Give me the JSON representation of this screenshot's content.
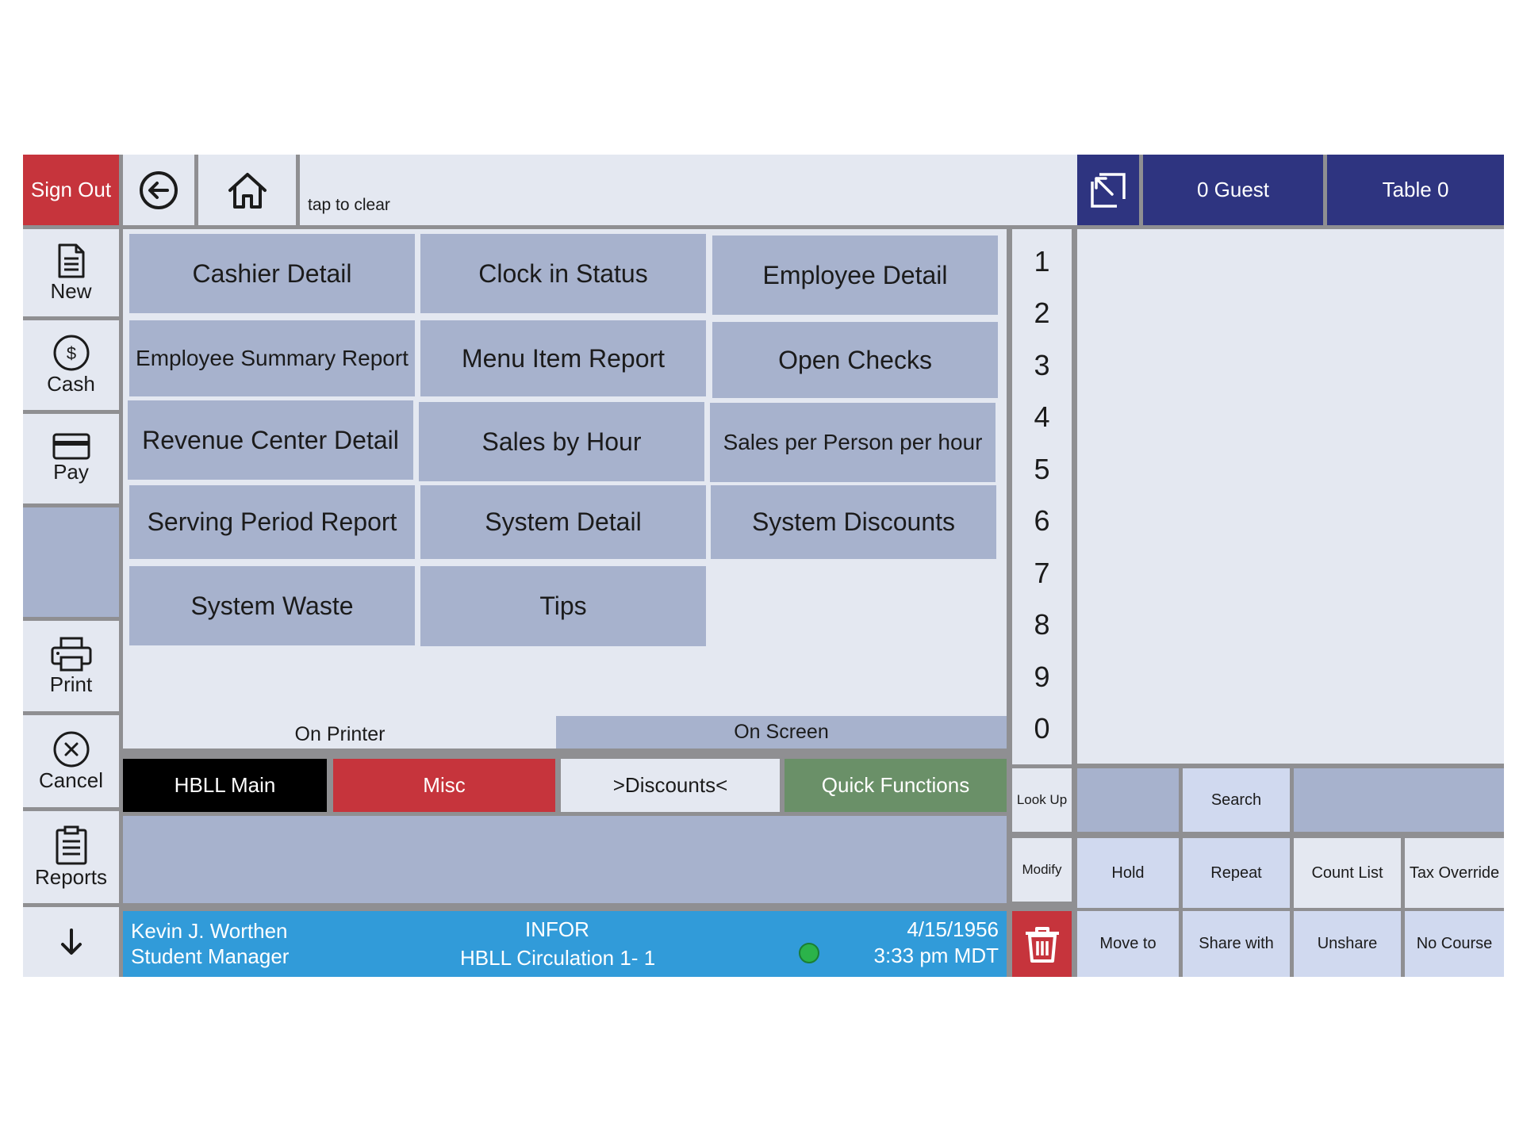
{
  "topbar": {
    "sign_out": "Sign Out",
    "back_icon": "back-arrow-icon",
    "home_icon": "home-icon",
    "input_hint": "tap to clear",
    "expand_icon": "expand-icon",
    "guest": "0 Guest",
    "table": "Table 0"
  },
  "sidebar": {
    "items": [
      {
        "label": "New",
        "icon": "document-icon"
      },
      {
        "label": "Cash",
        "icon": "dollar-icon"
      },
      {
        "label": "Pay",
        "icon": "card-icon"
      },
      {
        "label": ""
      },
      {
        "label": "Print",
        "icon": "printer-icon"
      },
      {
        "label": "Cancel",
        "icon": "cancel-icon"
      },
      {
        "label": "Reports",
        "icon": "clipboard-icon"
      },
      {
        "label": "",
        "icon": "down-arrow-icon"
      }
    ]
  },
  "reports": [
    "Cashier Detail",
    "Clock in Status",
    "Employee Detail",
    "Employee Summary Report",
    "Menu Item Report",
    "Open Checks",
    "Revenue Center Detail",
    "Sales by Hour",
    "Sales per Person per hour",
    "Serving Period Report",
    "System Detail",
    "System Discounts",
    "System Waste",
    "Tips"
  ],
  "output": {
    "on_printer": "On Printer",
    "on_screen": "On Screen"
  },
  "bottom_tabs": [
    "HBLL Main",
    "Misc",
    ">Discounts<",
    "Quick Functions"
  ],
  "numpad": [
    "1",
    "2",
    "3",
    "4",
    "5",
    "6",
    "7",
    "8",
    "9",
    "0"
  ],
  "status_bar": {
    "name": "Kevin J. Worthen",
    "role": "Student Manager",
    "brand": "INFOR",
    "location": "HBLL Circulation 1- 1",
    "date": "4/15/1956",
    "time": "3:33 pm MDT",
    "indicator_color": "#2bb34a"
  },
  "functions": {
    "look_up": "Look Up",
    "modify": "Modify",
    "trash_icon": "trash-icon",
    "search": "Search",
    "hold": "Hold",
    "repeat": "Repeat",
    "count_list": "Count List",
    "tax_override": "Tax Override",
    "move_to": "Move to",
    "share_with": "Share with",
    "unshare": "Unshare",
    "no_course": "No Course"
  },
  "colors": {
    "accent_navy": "#2e3480",
    "alert_red": "#c6343c",
    "tab_main": "#000000",
    "tab_quick": "#6a9068",
    "status_blue": "#319bd9"
  }
}
